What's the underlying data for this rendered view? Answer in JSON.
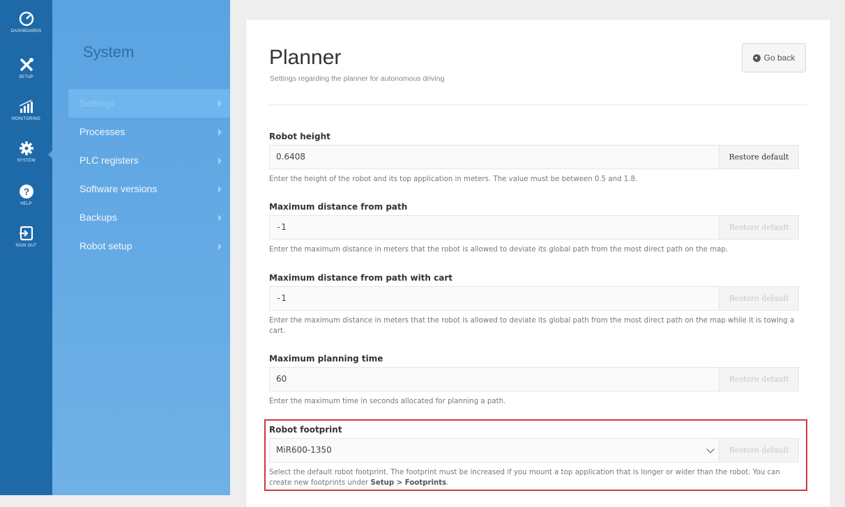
{
  "rail": [
    {
      "label": "DASHBOARDS",
      "icon": "dashboard-gauge-icon"
    },
    {
      "label": "SETUP",
      "icon": "tools-icon"
    },
    {
      "label": "MONITORING",
      "icon": "monitoring-chart-icon"
    },
    {
      "label": "SYSTEM",
      "icon": "gear-icon"
    },
    {
      "label": "HELP",
      "icon": "help-question-icon"
    },
    {
      "label": "SIGN OUT",
      "icon": "sign-out-icon"
    }
  ],
  "section": {
    "title": "System",
    "menu": [
      {
        "label": "Settings",
        "active": true
      },
      {
        "label": "Processes"
      },
      {
        "label": "PLC registers"
      },
      {
        "label": "Software versions"
      },
      {
        "label": "Backups"
      },
      {
        "label": "Robot setup"
      }
    ]
  },
  "page": {
    "title": "Planner",
    "subtitle": "Settings regarding the planner for autonomous driving",
    "back_label": "Go back"
  },
  "fields": [
    {
      "label": "Robot height",
      "value": "0.6408",
      "restore_label": "Restore default",
      "restore_enabled": true,
      "help": "Enter the height of the robot and its top application in meters. The value must be between 0.5 and 1.8."
    },
    {
      "label": "Maximum distance from path",
      "value": "-1",
      "restore_label": "Restore default",
      "restore_enabled": false,
      "help": "Enter the maximum distance in meters that the robot is allowed to deviate its global path from the most direct path on the map."
    },
    {
      "label": "Maximum distance from path with cart",
      "value": "-1",
      "restore_label": "Restore default",
      "restore_enabled": false,
      "help": "Enter the maximum distance in meters that the robot is allowed to deviate its global path from the most direct path on the map while it is towing a cart."
    },
    {
      "label": "Maximum planning time",
      "value": "60",
      "restore_label": "Restore default",
      "restore_enabled": false,
      "help": "Enter the maximum time in seconds allocated for planning a path."
    },
    {
      "label": "Robot footprint",
      "value": "MiR600-1350",
      "restore_label": "Restore default",
      "restore_enabled": false,
      "help": "Select the default robot footprint. The footprint must be increased if you mount a top application that is longer or wider than the robot. You can create new footprints under",
      "help_link": "Setup > Footprints",
      "help_end": "."
    }
  ],
  "colors": {
    "rail": "#1e6aa8",
    "sidebar": "#5aa3e2",
    "highlight": "#d2363a"
  }
}
